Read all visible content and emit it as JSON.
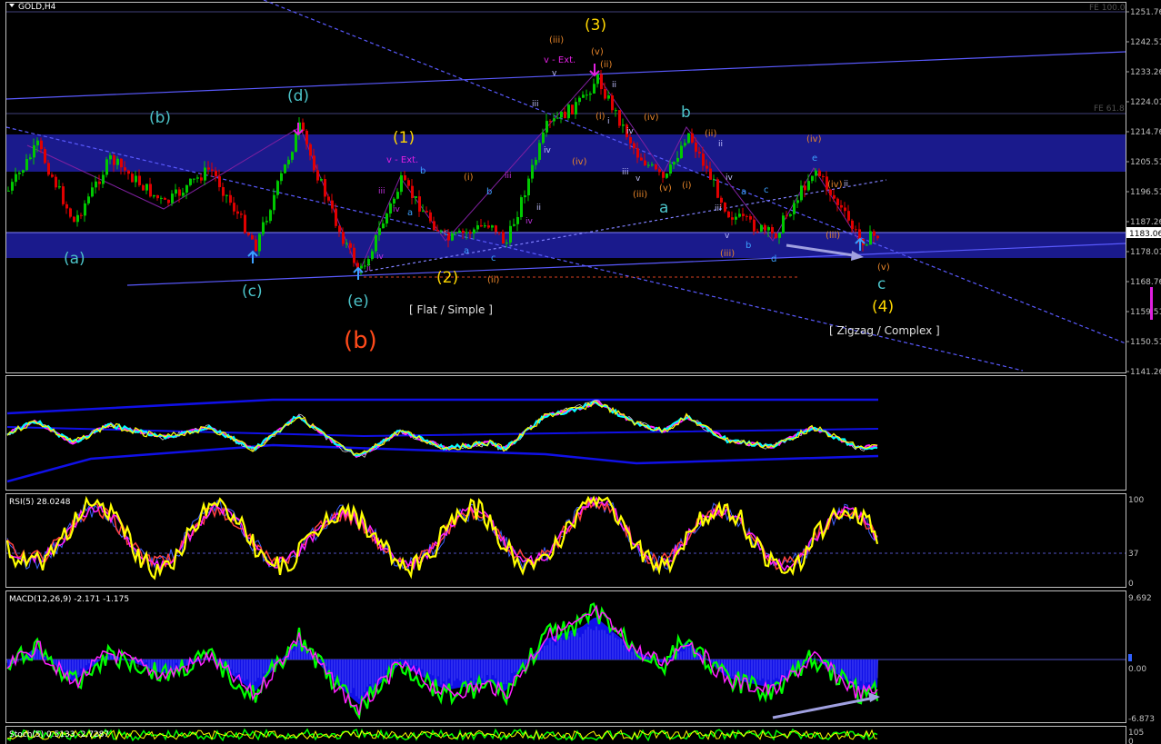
{
  "window": {
    "symbol_title": "GOLD,H4"
  },
  "colors": {
    "background": "#000000",
    "bull": "#00c800",
    "bear": "#e00000",
    "zone": "#1a1a8c",
    "axis": "#a0a0a0",
    "wave_yellow": "#ffd700",
    "wave_cyan": "#4cc3c9",
    "wave_orange": "#e8862a",
    "wave_b_red": "#ff4a1a",
    "magenta": "#e020e0",
    "rsi_line": "#ffff00",
    "macd_hist": "#1010e8",
    "macd_green": "#00ff00"
  },
  "price_axis": {
    "ticks": [
      "1251.76",
      "1242.51",
      "1233.26",
      "1224.01",
      "1214.76",
      "1205.51",
      "1196.51",
      "1187.26",
      "1178.01",
      "1168.76",
      "1159.51",
      "1150.51",
      "1141.26"
    ],
    "current_price": "1183.06"
  },
  "fib_labels": {
    "fe100": "FE 100.0",
    "fe618": "FE 61.8"
  },
  "chart_data": [
    {
      "type": "candlestick",
      "title": "GOLD,H4",
      "ylim": [
        1141.26,
        1251.76
      ],
      "current_price": 1183.06,
      "wave_labels": {
        "cyan": [
          "(a)",
          "(b)",
          "(c)",
          "(d)",
          "(e)",
          "a",
          "b",
          "c"
        ],
        "yellow": [
          "(1)",
          "(2)",
          "(3)",
          "(4)"
        ],
        "red": [
          "(b)"
        ],
        "orange": [
          "(i)",
          "(ii)",
          "(iii)",
          "(iv)",
          "(v)",
          "(i)",
          "(ii)",
          "(iii)",
          "(iv)",
          "(v)",
          "(ii)",
          "(iii)",
          "(iv)",
          "(v)",
          "(i)",
          "(ii)",
          "(iii)",
          "(iv)",
          "(iii)"
        ],
        "magenta": [
          "v - Ext.",
          "v - Ext."
        ],
        "small": [
          "i",
          "ii",
          "iii",
          "iv",
          "v",
          "a",
          "b",
          "c",
          "d",
          "e"
        ]
      },
      "annotations": [
        "[ Flat / Simple ]",
        "[ Zigzag / Complex ]"
      ]
    },
    {
      "type": "line",
      "title": "",
      "note": "moving-average envelope oscillator"
    },
    {
      "type": "line",
      "title": "RSI(5) 28.0248",
      "ylim": [
        0,
        100
      ],
      "ticks": [
        "100",
        "37",
        "0"
      ]
    },
    {
      "type": "area",
      "title": "MACD(12,26,9) -2.171 -1.175",
      "ticks": [
        "9.692",
        "0.00",
        "-6.873"
      ]
    },
    {
      "type": "line",
      "title": "Stoch(5) 0.5133 -2.7287",
      "ticks": [
        "105",
        "0"
      ]
    }
  ],
  "labels": {
    "a_paren": "(a)",
    "b_paren": "(b)",
    "c_paren": "(c)",
    "d_paren": "(d)",
    "e_paren": "(e)",
    "b_big": "(b)",
    "w1": "(1)",
    "w2": "(2)",
    "w3": "(3)",
    "w4": "(4)",
    "a": "a",
    "b": "b",
    "c": "c",
    "vext1": "v - Ext.",
    "vext2": "v - Ext.",
    "flat": "[ Flat / Simple ]",
    "zigzag": "[ Zigzag / Complex ]"
  },
  "rsi": {
    "title": "RSI(5) 28.0248",
    "ticks": [
      "100",
      "37",
      "0"
    ]
  },
  "macd": {
    "title": "MACD(12,26,9) -2.171 -1.175",
    "ticks": [
      "9.692",
      "0.00",
      "-6.873"
    ]
  },
  "stoch": {
    "title": "Stoch(5) 0.5133 -2.7287",
    "ticks": [
      "105",
      "0"
    ]
  }
}
